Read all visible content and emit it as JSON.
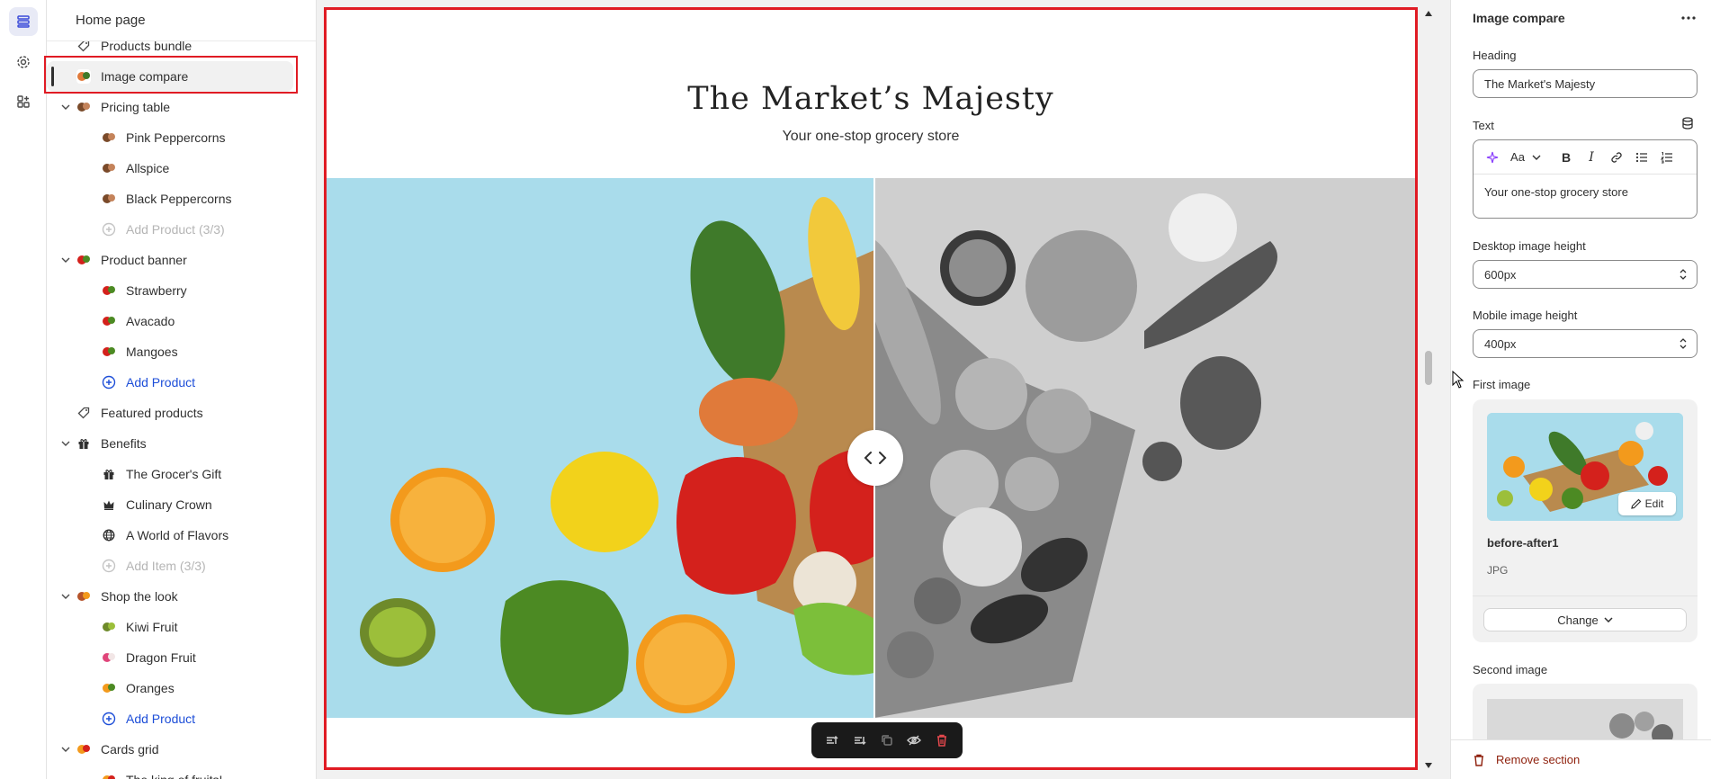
{
  "sidebar": {
    "header": "Home page",
    "items": [
      {
        "label": "Products bundle",
        "level": 1,
        "kind": "section",
        "icon": "tag-icon",
        "chevron": false
      },
      {
        "label": "Image compare",
        "level": 1,
        "kind": "section",
        "icon": "image-thumb",
        "chevron": false,
        "selected": true
      },
      {
        "label": "Pricing table",
        "level": 1,
        "kind": "section",
        "icon": "pricing-thumb",
        "chevron": true
      },
      {
        "label": "Pink Peppercorns",
        "level": 2,
        "kind": "block",
        "icon": "pricing-thumb"
      },
      {
        "label": "Allspice",
        "level": 2,
        "kind": "block",
        "icon": "pricing-thumb"
      },
      {
        "label": "Black Peppercorns",
        "level": 2,
        "kind": "block",
        "icon": "pricing-thumb"
      },
      {
        "label": "Add Product (3/3)",
        "level": 2,
        "kind": "add-disabled",
        "icon": "plus-circle-icon"
      },
      {
        "label": "Product banner",
        "level": 1,
        "kind": "section",
        "icon": "banner-thumb",
        "chevron": true
      },
      {
        "label": "Strawberry",
        "level": 2,
        "kind": "block",
        "icon": "banner-thumb"
      },
      {
        "label": "Avacado",
        "level": 2,
        "kind": "block",
        "icon": "banner-thumb"
      },
      {
        "label": "Mangoes",
        "level": 2,
        "kind": "block",
        "icon": "banner-thumb"
      },
      {
        "label": "Add Product",
        "level": 2,
        "kind": "add",
        "icon": "plus-circle-icon"
      },
      {
        "label": "Featured products",
        "level": 1,
        "kind": "section",
        "icon": "tag-icon",
        "chevron": false
      },
      {
        "label": "Benefits",
        "level": 1,
        "kind": "section",
        "icon": "gift-icon",
        "chevron": true
      },
      {
        "label": "The Grocer's Gift",
        "level": 2,
        "kind": "block",
        "icon": "gift-icon"
      },
      {
        "label": "Culinary Crown",
        "level": 2,
        "kind": "block",
        "icon": "crown-icon"
      },
      {
        "label": "A World of Flavors",
        "level": 2,
        "kind": "block",
        "icon": "globe-icon"
      },
      {
        "label": "Add Item (3/3)",
        "level": 2,
        "kind": "add-disabled",
        "icon": "plus-circle-icon"
      },
      {
        "label": "Shop the look",
        "level": 1,
        "kind": "section",
        "icon": "look-thumb",
        "chevron": true
      },
      {
        "label": "Kiwi Fruit",
        "level": 2,
        "kind": "block",
        "icon": "kiwi-thumb"
      },
      {
        "label": "Dragon Fruit",
        "level": 2,
        "kind": "block",
        "icon": "dragon-thumb"
      },
      {
        "label": "Oranges",
        "level": 2,
        "kind": "block",
        "icon": "orange-thumb"
      },
      {
        "label": "Add Product",
        "level": 2,
        "kind": "add",
        "icon": "plus-circle-icon"
      },
      {
        "label": "Cards grid",
        "level": 1,
        "kind": "section",
        "icon": "cards-thumb",
        "chevron": true
      },
      {
        "label": "The king of fruits!",
        "level": 2,
        "kind": "block",
        "icon": "cards-thumb"
      }
    ]
  },
  "preview": {
    "heading": "The Market’s Majesty",
    "subheading": "Your one-stop grocery store",
    "compare_handle_icon": "chevron-left-right-icon"
  },
  "panel": {
    "title": "Image compare",
    "heading_label": "Heading",
    "heading_value": "The Market's Majesty",
    "text_label": "Text",
    "text_value": "Your one-stop grocery store",
    "rte_font_label": "Aa",
    "desktop_height_label": "Desktop image height",
    "desktop_height_value": "600px",
    "mobile_height_label": "Mobile image height",
    "mobile_height_value": "400px",
    "first_image_label": "First image",
    "first_image_name": "before-after1",
    "first_image_type": "JPG",
    "edit_label": "Edit",
    "change_label": "Change",
    "second_image_label": "Second image",
    "remove_label": "Remove section"
  },
  "colors": {
    "accent_red_outline": "#e01b24",
    "add_link_blue": "#1d4ed8",
    "remove_red": "#8e1f0b",
    "toolbar_dark": "#1a1a1a"
  }
}
